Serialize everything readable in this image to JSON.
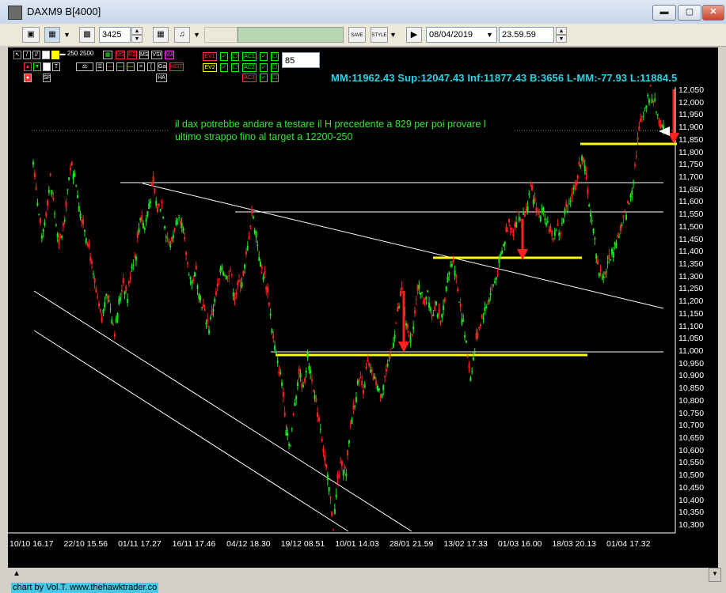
{
  "window": {
    "title": "DAXM9 B[4000]",
    "minimize_glyph": "▬",
    "maximize_glyph": "▢",
    "close_glyph": "✕"
  },
  "toolbar": {
    "bars_value": "3425",
    "date_value": "08/04/2019",
    "time_value": "23.59.59",
    "save_label": "SAVE",
    "style_label": "STYLE",
    "dropdown_glyph": "▼",
    "spin_up": "▲",
    "spin_down": "▼",
    "play_glyph": "▶"
  },
  "indicators": {
    "params_label": "250 2500",
    "gap_label": "Gap",
    "hist_label": "HIST",
    "ev1_label": "EV1",
    "ev2_label": "EV2",
    "ac1_label": "AC1",
    "ac2_label": "AC2",
    "ac3_label": "AC3",
    "ha_label": "HA",
    "sp_label": "SP",
    "vsi_label": "VSI",
    "ms_label": "MS",
    "ma_label": "MA",
    "ms2_label": "MS",
    "rs_label": "RS",
    "ms3_label": "MS",
    "value_box": "85"
  },
  "chart": {
    "status": "MM:11962.43 Sup:12047.43 Inf:11877.43 B:3656 L-MM:-77.93 L:11884.5",
    "annotation_line1": "il dax potrebbe andare a testare il H precedente a 829 per poi provare l",
    "annotation_line2": "ultimo strappo fino al target a 12200-250",
    "footer_credit": "chart by Vol.T. www.thehawktrader.co",
    "colors": {
      "up": "#1fe01f",
      "down": "#ff2020",
      "support": "#ffff00",
      "line": "#ffffff",
      "status": "#28d2e6"
    }
  },
  "chart_data": {
    "type": "line",
    "title": "",
    "ylim": [
      10275,
      12075
    ],
    "yticks": [
      12050,
      12000,
      11950,
      11900,
      11850,
      11800,
      11750,
      11700,
      11650,
      11600,
      11550,
      11500,
      11450,
      11400,
      11350,
      11300,
      11250,
      11200,
      11150,
      11100,
      11050,
      11000,
      10950,
      10900,
      10850,
      10800,
      10750,
      10700,
      10650,
      10600,
      10550,
      10500,
      10450,
      10400,
      10350,
      10300
    ],
    "ytick_labels": [
      "12,050",
      "12,000",
      "11,950",
      "11,900",
      "11,850",
      "11,800",
      "11,750",
      "11,700",
      "11,650",
      "11,600",
      "11,550",
      "11,500",
      "11,450",
      "11,400",
      "11,350",
      "11,300",
      "11,250",
      "11,200",
      "11,150",
      "11,100",
      "11,050",
      "11,000",
      "10,950",
      "10,900",
      "10,850",
      "10,800",
      "10,750",
      "10,700",
      "10,650",
      "10,600",
      "10,550",
      "10,500",
      "10,450",
      "10,400",
      "10,350",
      "10,300"
    ],
    "xtick_labels": [
      "10/10 16.17",
      "22/10 15.56",
      "01/11 17.27",
      "16/11 17.46",
      "04/12 18.30",
      "19/12 08.51",
      "10/01 14.03",
      "28/01 21.59",
      "13/02 17.33",
      "01/03 16.00",
      "18/03 20.13",
      "01/04 17.32"
    ],
    "series": [
      {
        "values": [
          11780,
          11600,
          11450,
          11560,
          11700,
          11560,
          11420,
          11500,
          11650,
          11760,
          11680,
          11560,
          11500,
          11420,
          11300,
          11200,
          11120,
          11250,
          11180,
          11080,
          11200,
          11280,
          11220,
          11350,
          11400,
          11550,
          11500,
          11600,
          11670,
          11570,
          11600,
          11480,
          11420,
          11500,
          11560,
          11480,
          11350,
          11280,
          11320,
          11220,
          11150,
          11100,
          11180,
          11250,
          11350,
          11300,
          11330,
          11220,
          11270,
          11300,
          11420,
          11560,
          11480,
          11350,
          11300,
          11200,
          11050,
          10950,
          10880,
          10700,
          10620,
          10800,
          10920,
          10850,
          10980,
          10900,
          10780,
          10700,
          10560,
          10450,
          10300,
          10480,
          10560,
          10500,
          10700,
          10800,
          10900,
          10850,
          10950,
          10900,
          10880,
          10820,
          10900,
          10950,
          11050,
          11150,
          11250,
          11100,
          11050,
          11150,
          11280,
          11200,
          11250,
          11150,
          11200,
          11100,
          11220,
          11320,
          11380,
          11250,
          11150,
          11030,
          10900,
          11010,
          11100,
          11150,
          11200,
          11250,
          11300,
          11380,
          11450,
          11520,
          11480,
          11550,
          11530,
          11580,
          11650,
          11600,
          11550,
          11570,
          11520,
          11450,
          11500,
          11480,
          11560,
          11600,
          11650,
          11700,
          11800,
          11700,
          11550,
          11450,
          11320,
          11300,
          11350,
          11400,
          11450,
          11480,
          11550,
          11600,
          11700,
          11850,
          11950,
          12000,
          12050,
          12000,
          11930,
          11890
        ]
      }
    ],
    "horizontal_levels": [
      {
        "value": 11840,
        "color": "#ffff00"
      },
      {
        "value": 11380,
        "color": "#ffff00"
      },
      {
        "value": 10988,
        "color": "#ffff00"
      },
      {
        "value": 11680,
        "color": "#ffffff"
      },
      {
        "value": 11565,
        "color": "#ffffff"
      },
      {
        "value": 11000,
        "color": "#ffffff"
      }
    ]
  }
}
